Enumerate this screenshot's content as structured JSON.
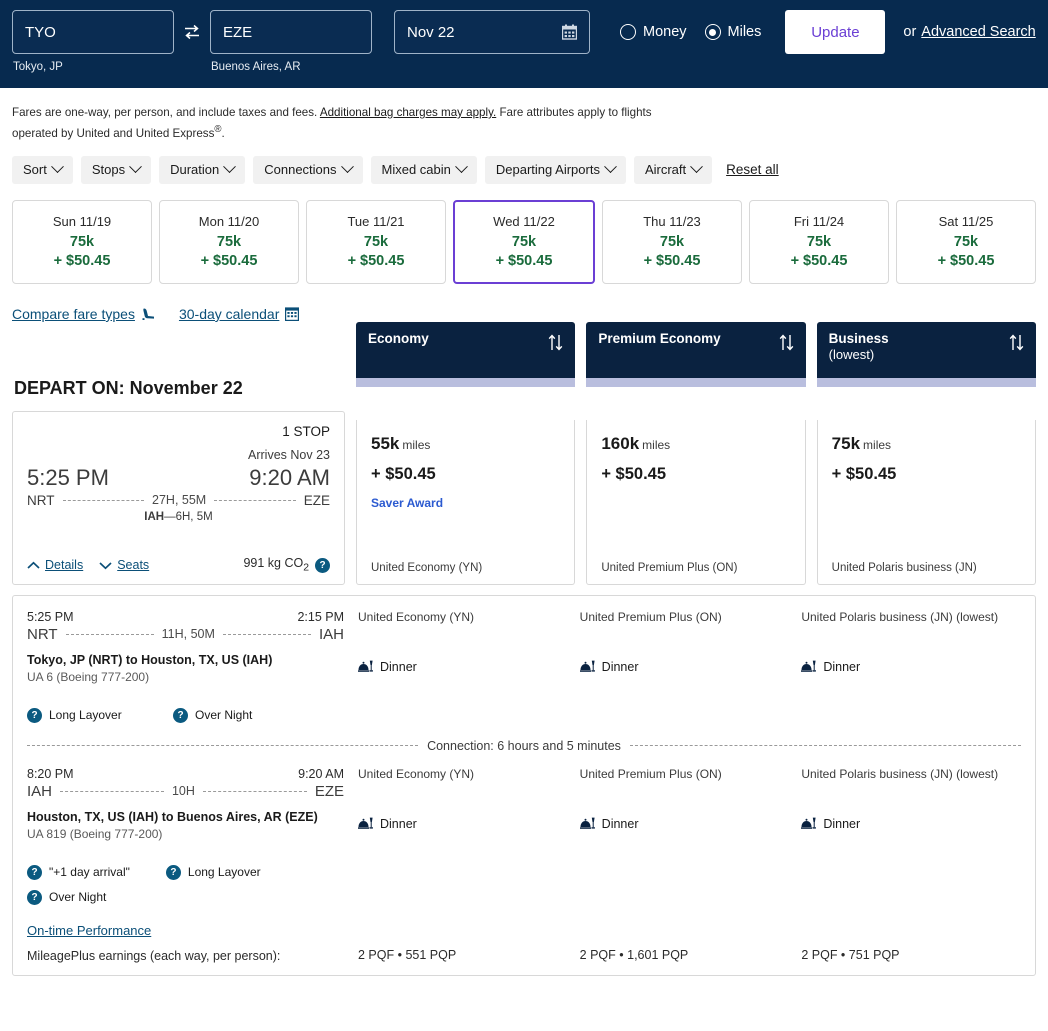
{
  "search": {
    "origin_code": "TYO",
    "origin_city": "Tokyo, JP",
    "dest_code": "EZE",
    "dest_city": "Buenos Aires, AR",
    "date_value": "Nov 22",
    "swap_icon": "swap-arrows-icon",
    "calendar_icon": "calendar-icon",
    "money_label": "Money",
    "miles_label": "Miles",
    "selected_currency": "Miles",
    "update_label": "Update",
    "or_label": "or",
    "advanced_label": "Advanced Search"
  },
  "disclaimer": {
    "part1": "Fares are one-way, per person, and include taxes and fees. ",
    "link": "Additional bag charges may apply.",
    "part2": " Fare attributes apply to flights operated by United and United Express",
    "superscript": "®",
    "part3": "."
  },
  "filters": {
    "chips": [
      "Sort",
      "Stops",
      "Duration",
      "Connections",
      "Mixed cabin",
      "Departing Airports",
      "Aircraft"
    ],
    "reset_label": "Reset all"
  },
  "dates": [
    {
      "day": "Sun 11/19",
      "miles": "75k",
      "cash": "+ $50.45",
      "selected": false
    },
    {
      "day": "Mon 11/20",
      "miles": "75k",
      "cash": "+ $50.45",
      "selected": false
    },
    {
      "day": "Tue 11/21",
      "miles": "75k",
      "cash": "+ $50.45",
      "selected": false
    },
    {
      "day": "Wed 11/22",
      "miles": "75k",
      "cash": "+ $50.45",
      "selected": true
    },
    {
      "day": "Thu 11/23",
      "miles": "75k",
      "cash": "+ $50.45",
      "selected": false
    },
    {
      "day": "Fri 11/24",
      "miles": "75k",
      "cash": "+ $50.45",
      "selected": false
    },
    {
      "day": "Sat 11/25",
      "miles": "75k",
      "cash": "+ $50.45",
      "selected": false
    }
  ],
  "tools": {
    "compare_label": "Compare fare types",
    "compare_icon": "seat-icon",
    "calendar_label": "30-day calendar",
    "calendar_icon": "calendar-grid-icon"
  },
  "results": {
    "depart_title": "DEPART ON: November 22",
    "cabins": [
      {
        "title": "Economy",
        "sub": "",
        "sort_icon": "sort-updown-icon"
      },
      {
        "title": "Premium Economy",
        "sub": "",
        "sort_icon": "sort-updown-icon"
      },
      {
        "title": "Business",
        "sub": "(lowest)",
        "sort_icon": "sort-updown-icon"
      }
    ],
    "flight": {
      "stops": "1 STOP",
      "arrives": "Arrives Nov 23",
      "depart_time": "5:25 PM",
      "arrive_time": "9:20 AM",
      "origin": "NRT",
      "destination": "EZE",
      "duration": "27H, 55M",
      "stopover_code": "IAH",
      "stopover_sep": "—",
      "stopover_dur": "6H, 5M",
      "details_label": "Details",
      "seats_label": "Seats",
      "co2": "991 kg CO",
      "co2_sub": "2",
      "help_glyph": "?"
    },
    "fares": [
      {
        "miles": "55k",
        "unit": "miles",
        "cash": "+ $50.45",
        "tag": "Saver Award",
        "name": "United Economy (YN)"
      },
      {
        "miles": "160k",
        "unit": "miles",
        "cash": "+ $50.45",
        "tag": "",
        "name": "United Premium Plus (ON)"
      },
      {
        "miles": "75k",
        "unit": "miles",
        "cash": "+ $50.45",
        "tag": "",
        "name": "United Polaris business (JN)"
      }
    ]
  },
  "details": {
    "segments": [
      {
        "depart_time": "5:25 PM",
        "arrive_time": "2:15 PM",
        "origin": "NRT",
        "destination": "IAH",
        "duration": "11H, 50M",
        "city_pair": "Tokyo, JP (NRT) to Houston, TX, US (IAH)",
        "flight_no": "UA 6 (Boeing 777-200)",
        "badges": [
          {
            "label": "Long Layover",
            "glyph": "?"
          },
          {
            "label": "Over Night",
            "glyph": "?"
          }
        ],
        "cabins": [
          {
            "name": "United Economy (YN)",
            "meal": "Dinner",
            "meal_icon": "meal-dome-icon"
          },
          {
            "name": "United Premium Plus (ON)",
            "meal": "Dinner",
            "meal_icon": "meal-dome-icon"
          },
          {
            "name": "United Polaris business (JN) (lowest)",
            "meal": "Dinner",
            "meal_icon": "meal-dome-icon"
          }
        ]
      },
      {
        "depart_time": "8:20 PM",
        "arrive_time": "9:20 AM",
        "origin": "IAH",
        "destination": "EZE",
        "duration": "10H",
        "city_pair": "Houston, TX, US (IAH) to Buenos Aires, AR (EZE)",
        "flight_no": "UA 819 (Boeing 777-200)",
        "badges": [
          {
            "label": "\"+1 day arrival\"",
            "glyph": "?"
          },
          {
            "label": "Long Layover",
            "glyph": "?"
          },
          {
            "label": "Over Night",
            "glyph": "?"
          }
        ],
        "cabins": [
          {
            "name": "United Economy (YN)",
            "meal": "Dinner",
            "meal_icon": "meal-dome-icon"
          },
          {
            "name": "United Premium Plus (ON)",
            "meal": "Dinner",
            "meal_icon": "meal-dome-icon"
          },
          {
            "name": "United Polaris business (JN) (lowest)",
            "meal": "Dinner",
            "meal_icon": "meal-dome-icon"
          }
        ]
      }
    ],
    "connection_text": "Connection: 6 hours and 5 minutes",
    "otp_label": "On-time Performance",
    "earnings_label": "MileagePlus earnings (each way, per person):",
    "earnings": [
      "2 PQF • 551 PQP",
      "2 PQF • 1,601 PQP",
      "2 PQF • 751 PQP"
    ]
  },
  "colors": {
    "navy": "#072a4f",
    "card_navy": "#0a2240",
    "purple": "#6b3fd4",
    "green": "#1a6b3c",
    "link_blue": "#0b4f78",
    "saver_blue": "#2b5ad0",
    "lavender": "#b9bede"
  }
}
